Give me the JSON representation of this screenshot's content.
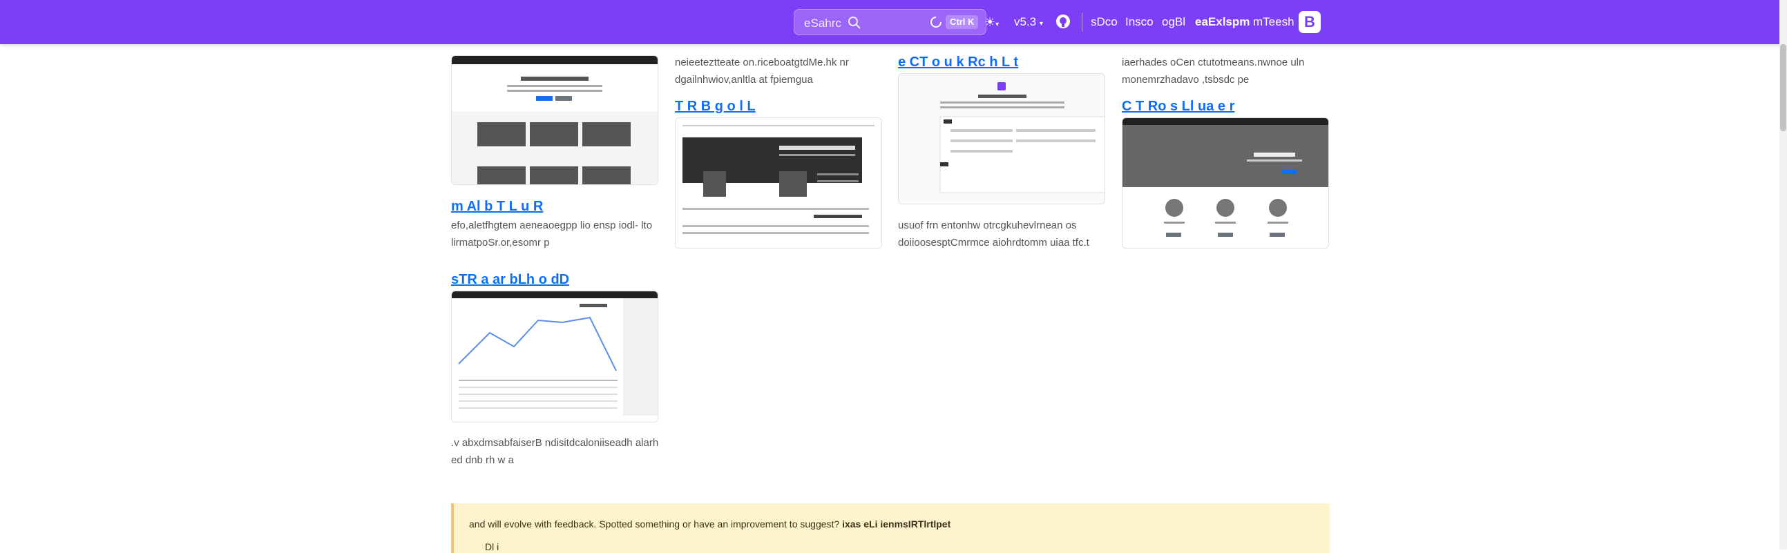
{
  "navbar": {
    "search_placeholder": "eSahrc",
    "shortcut": "Ctrl K",
    "version": "v5.3",
    "links": [
      "sDco",
      "Insco",
      "ogBl",
      "eaExlspm",
      "mTeesh"
    ],
    "active_link": "eaExlspm",
    "brand_letter": "B",
    "accent": "#7d3ff5"
  },
  "top_descs": {
    "col2": "neieeteztteate on.riceboatgtdMe.hk nr dgailnhwiov,anltla at fpiemgua",
    "col4": "iaerhades oCen ctutotmeans.nwnoe uln monemrzhadavo ,tsbsdc pe"
  },
  "cards": [
    {
      "title": "m Al b T L u R",
      "desc": "efo,aletfhgtem aeneaoegpp lio ensp iodl- lto lirmatpoSr.or,esomr p"
    },
    {
      "title": "T R B g o l L",
      "desc": ""
    },
    {
      "title": "e CT o u k Rc h L t",
      "desc": "usuof frn entonhw otrcgkuhevlrnean os doiioosesptCmrmce aiohrdtomm uiaa tfc.t"
    },
    {
      "title": "C T Ro s Ll ua e r",
      "desc": ""
    },
    {
      "title": "sTR a ar bLh o dD",
      "desc": ".v abxdmsabfaiserB ndisitdcaloniiseadh alarh ed dnb rh w a"
    }
  ],
  "callout": {
    "text": "and will evolve with feedback. Spotted something or have an improvement to suggest?",
    "link": "ixas eLi ienmsIRTlrtlpet",
    "sub": "Dl i"
  }
}
